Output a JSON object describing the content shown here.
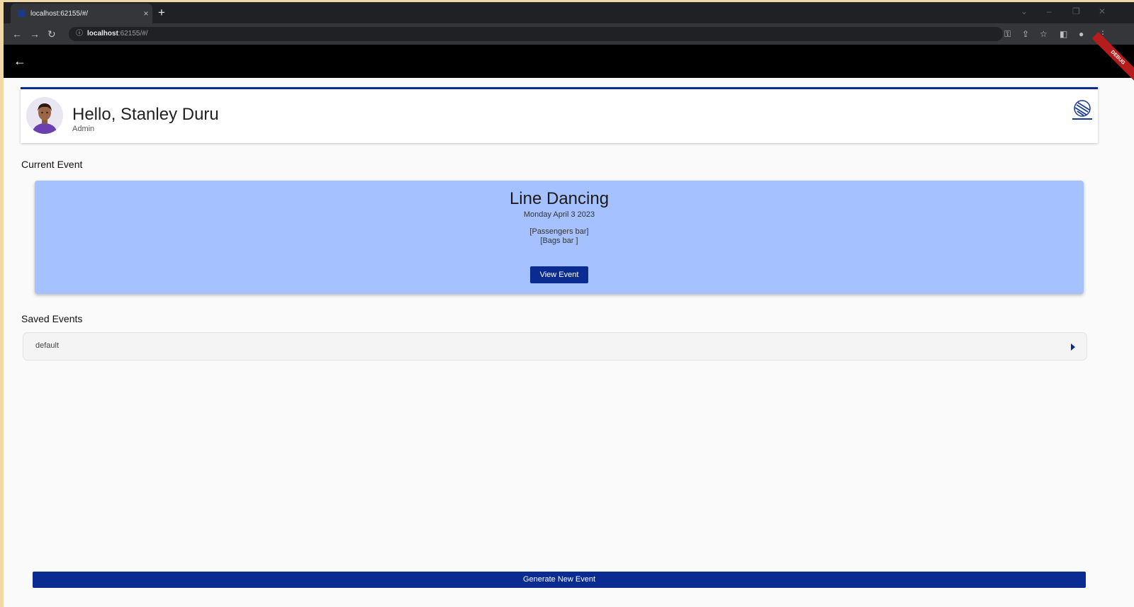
{
  "browser": {
    "tab_title": "localhost:62155/#/",
    "tab_close": "×",
    "new_tab": "+",
    "url_info_icon": "ⓘ",
    "url_host": "localhost",
    "url_rest": ":62155/#/",
    "icons": [
      "key-icon",
      "share-icon",
      "star-icon",
      "sidepanel-icon",
      "profile-icon",
      "menu-icon"
    ]
  },
  "appbar": {
    "back_icon": "←",
    "debug_banner": "DEBUG"
  },
  "header": {
    "greeting": "Hello, Stanley Duru",
    "role": "Admin"
  },
  "current_event": {
    "section_title": "Current Event",
    "name": "Line Dancing",
    "date": "Monday April 3 2023",
    "passengers_bar": "[Passengers bar]",
    "bags_bar": "[Bags bar ]",
    "view_button": "View Event",
    "card_color": "#a6c1ff"
  },
  "saved_events": {
    "section_title": "Saved Events",
    "items": [
      {
        "label": "default"
      }
    ]
  },
  "footer": {
    "generate_button": "Generate New Event"
  },
  "colors": {
    "primary": "#0a2b8f",
    "appbar": "#000000"
  }
}
